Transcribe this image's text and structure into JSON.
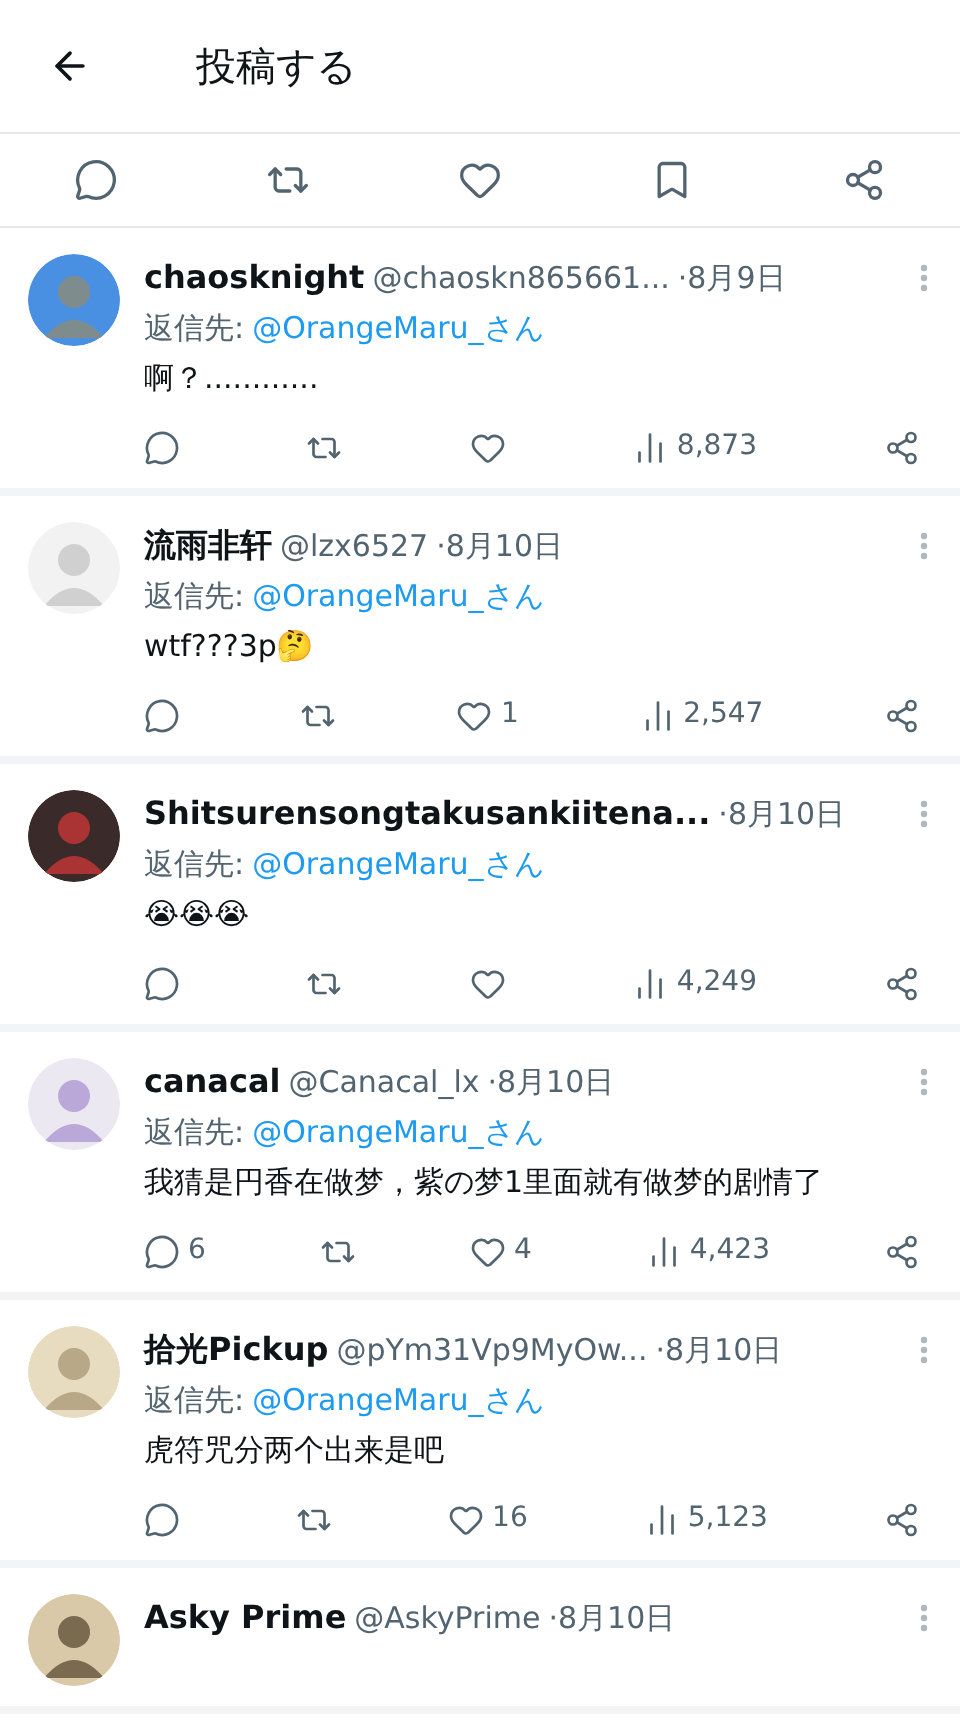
{
  "header": {
    "title": "投稿する"
  },
  "posts": [
    {
      "name": "chaosknight",
      "handle": "@chaoskn865661...",
      "date": "·8月9日",
      "reply_prefix": "返信先:",
      "reply_to": "@OrangeMaru_さん",
      "body": "啊？............",
      "views": "8,873"
    },
    {
      "name": "流雨非轩",
      "handle": "@lzx6527",
      "date": "·8月10日",
      "reply_prefix": "返信先:",
      "reply_to": "@OrangeMaru_さん",
      "body": "wtf???3p🤔",
      "likes": "1",
      "views": "2,547"
    },
    {
      "name": "Shitsurensongtakusankiitena...",
      "date": "·8月10日",
      "reply_prefix": "返信先:",
      "reply_to": "@OrangeMaru_さん",
      "body": "😭😭😭",
      "views": "4,249"
    },
    {
      "name": "canacal",
      "handle": "@Canacal_lx",
      "date": "·8月10日",
      "reply_prefix": "返信先:",
      "reply_to": "@OrangeMaru_さん",
      "body": "我猜是円香在做梦，紫の梦1里面就有做梦的剧情了",
      "replies": "6",
      "likes": "4",
      "views": "4,423"
    },
    {
      "name": "拾光Pickup",
      "handle": "@pYm31Vp9MyOw...",
      "date": "·8月10日",
      "reply_prefix": "返信先:",
      "reply_to": "@OrangeMaru_さん",
      "body": "虎符咒分两个出来是吧",
      "likes": "16",
      "views": "5,123"
    },
    {
      "name": "Asky Prime",
      "handle": "@AskyPrime",
      "date": "·8月10日"
    }
  ]
}
